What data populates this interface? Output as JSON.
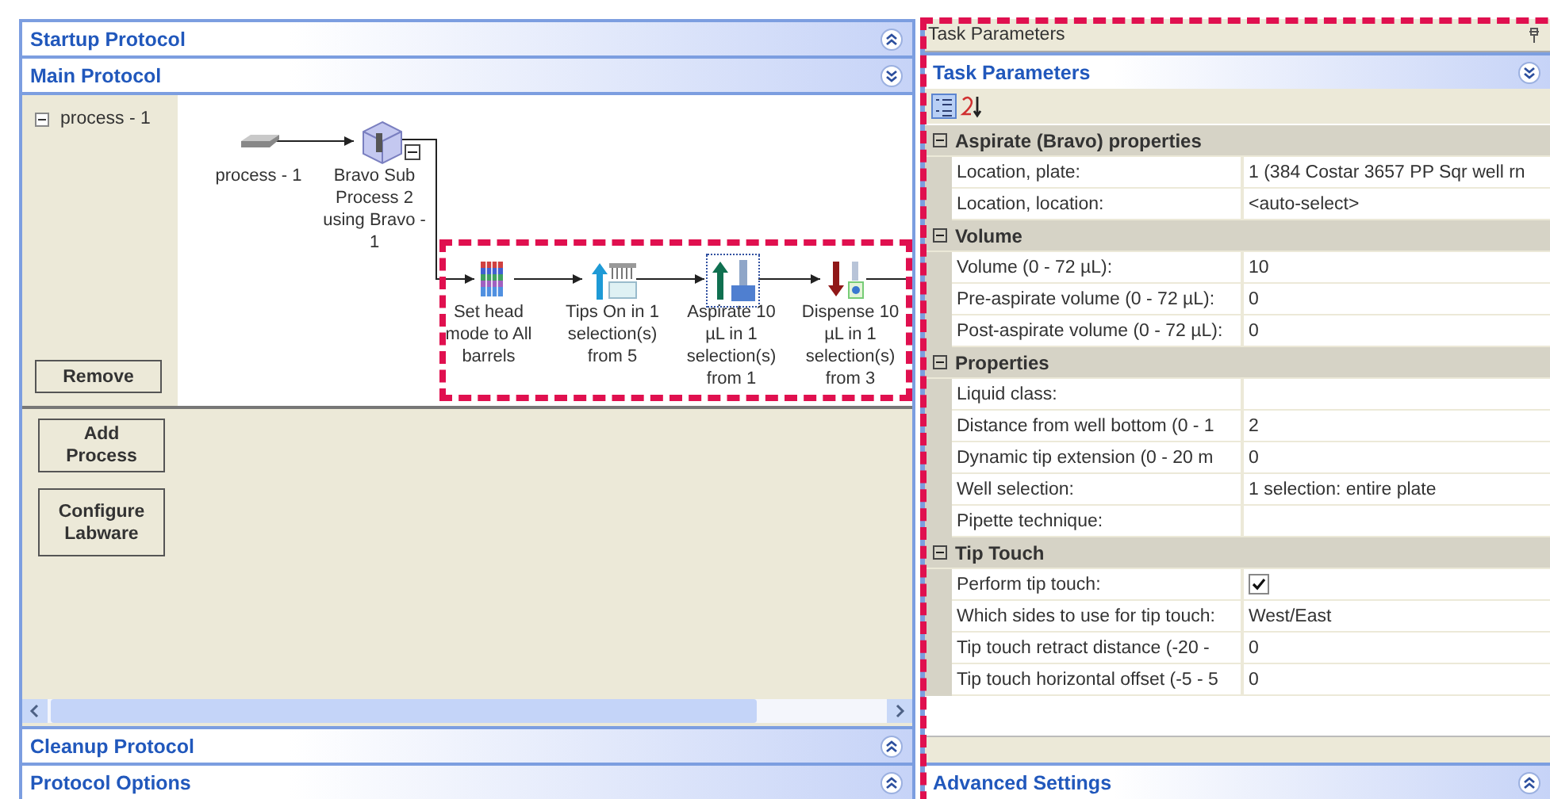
{
  "protocol_sections": [
    {
      "title": "Startup Protocol",
      "expanded": false
    },
    {
      "title": "Main Protocol",
      "expanded": true
    },
    {
      "title": "Cleanup Protocol",
      "expanded": false
    },
    {
      "title": "Protocol Options",
      "expanded": false
    }
  ],
  "main_protocol": {
    "tree": [
      {
        "label": "process - 1",
        "expanded": true
      }
    ],
    "remove_button": "Remove",
    "flow": [
      {
        "kind": "start",
        "label": "process - 1",
        "selected": false
      },
      {
        "kind": "subprocess",
        "label": "Bravo Sub Process 2 using Bravo - 1",
        "selected": false,
        "expanded": true
      },
      {
        "kind": "head-mode",
        "label": "Set head mode to All barrels",
        "selected": false
      },
      {
        "kind": "tips-on",
        "label": "Tips On in 1 selection(s) from 5",
        "selected": false
      },
      {
        "kind": "aspirate",
        "label": "Aspirate 10 µL in 1 selection(s) from 1",
        "selected": true
      },
      {
        "kind": "dispense",
        "label": "Dispense 10 µL in 1 selection(s) from 3",
        "selected": false
      }
    ],
    "actions": [
      "Add Process",
      "Configure Labware"
    ]
  },
  "task_parameters": {
    "window_title": "Task Parameters",
    "header": {
      "title": "Task Parameters",
      "expanded": true
    },
    "toolbar": [
      {
        "kind": "categorized",
        "selected": true
      },
      {
        "kind": "alphabetical",
        "selected": false
      }
    ],
    "categories": [
      {
        "title": "Aspirate (Bravo) properties",
        "expanded": true,
        "rows": [
          {
            "kind": "text",
            "label": "Location, plate:",
            "value": "1  (384 Costar 3657 PP Sqr well rn"
          },
          {
            "kind": "text",
            "label": "Location, location:",
            "value": "<auto-select>"
          }
        ]
      },
      {
        "title": "Volume",
        "expanded": true,
        "rows": [
          {
            "kind": "text",
            "label": "Volume (0 - 72 µL):",
            "value": "10"
          },
          {
            "kind": "text",
            "label": "Pre-aspirate volume (0 - 72 µL):",
            "value": "0"
          },
          {
            "kind": "text",
            "label": "Post-aspirate volume (0 - 72 µL):",
            "value": "0"
          }
        ]
      },
      {
        "title": "Properties",
        "expanded": true,
        "rows": [
          {
            "kind": "text",
            "label": "Liquid class:"
          },
          {
            "kind": "text",
            "label": "Distance from well bottom (0 - 1",
            "value": "2"
          },
          {
            "kind": "text",
            "label": "Dynamic tip extension (0 - 20 m",
            "value": "0"
          },
          {
            "kind": "text",
            "label": "Well selection:",
            "value": "1 selection: entire plate"
          },
          {
            "kind": "text",
            "label": "Pipette technique:"
          }
        ]
      },
      {
        "title": "Tip Touch",
        "expanded": true,
        "rows": [
          {
            "kind": "checkbox",
            "label": "Perform tip touch:",
            "checked": true
          },
          {
            "kind": "text",
            "label": "Which sides to use for tip touch:",
            "value": "West/East"
          },
          {
            "kind": "text",
            "label": "Tip touch retract distance (-20 -",
            "value": "0"
          },
          {
            "kind": "text",
            "label": "Tip touch horizontal offset (-5 - 5",
            "value": "0"
          }
        ]
      }
    ],
    "footer": {
      "title": "Advanced Settings",
      "expanded": false
    }
  }
}
